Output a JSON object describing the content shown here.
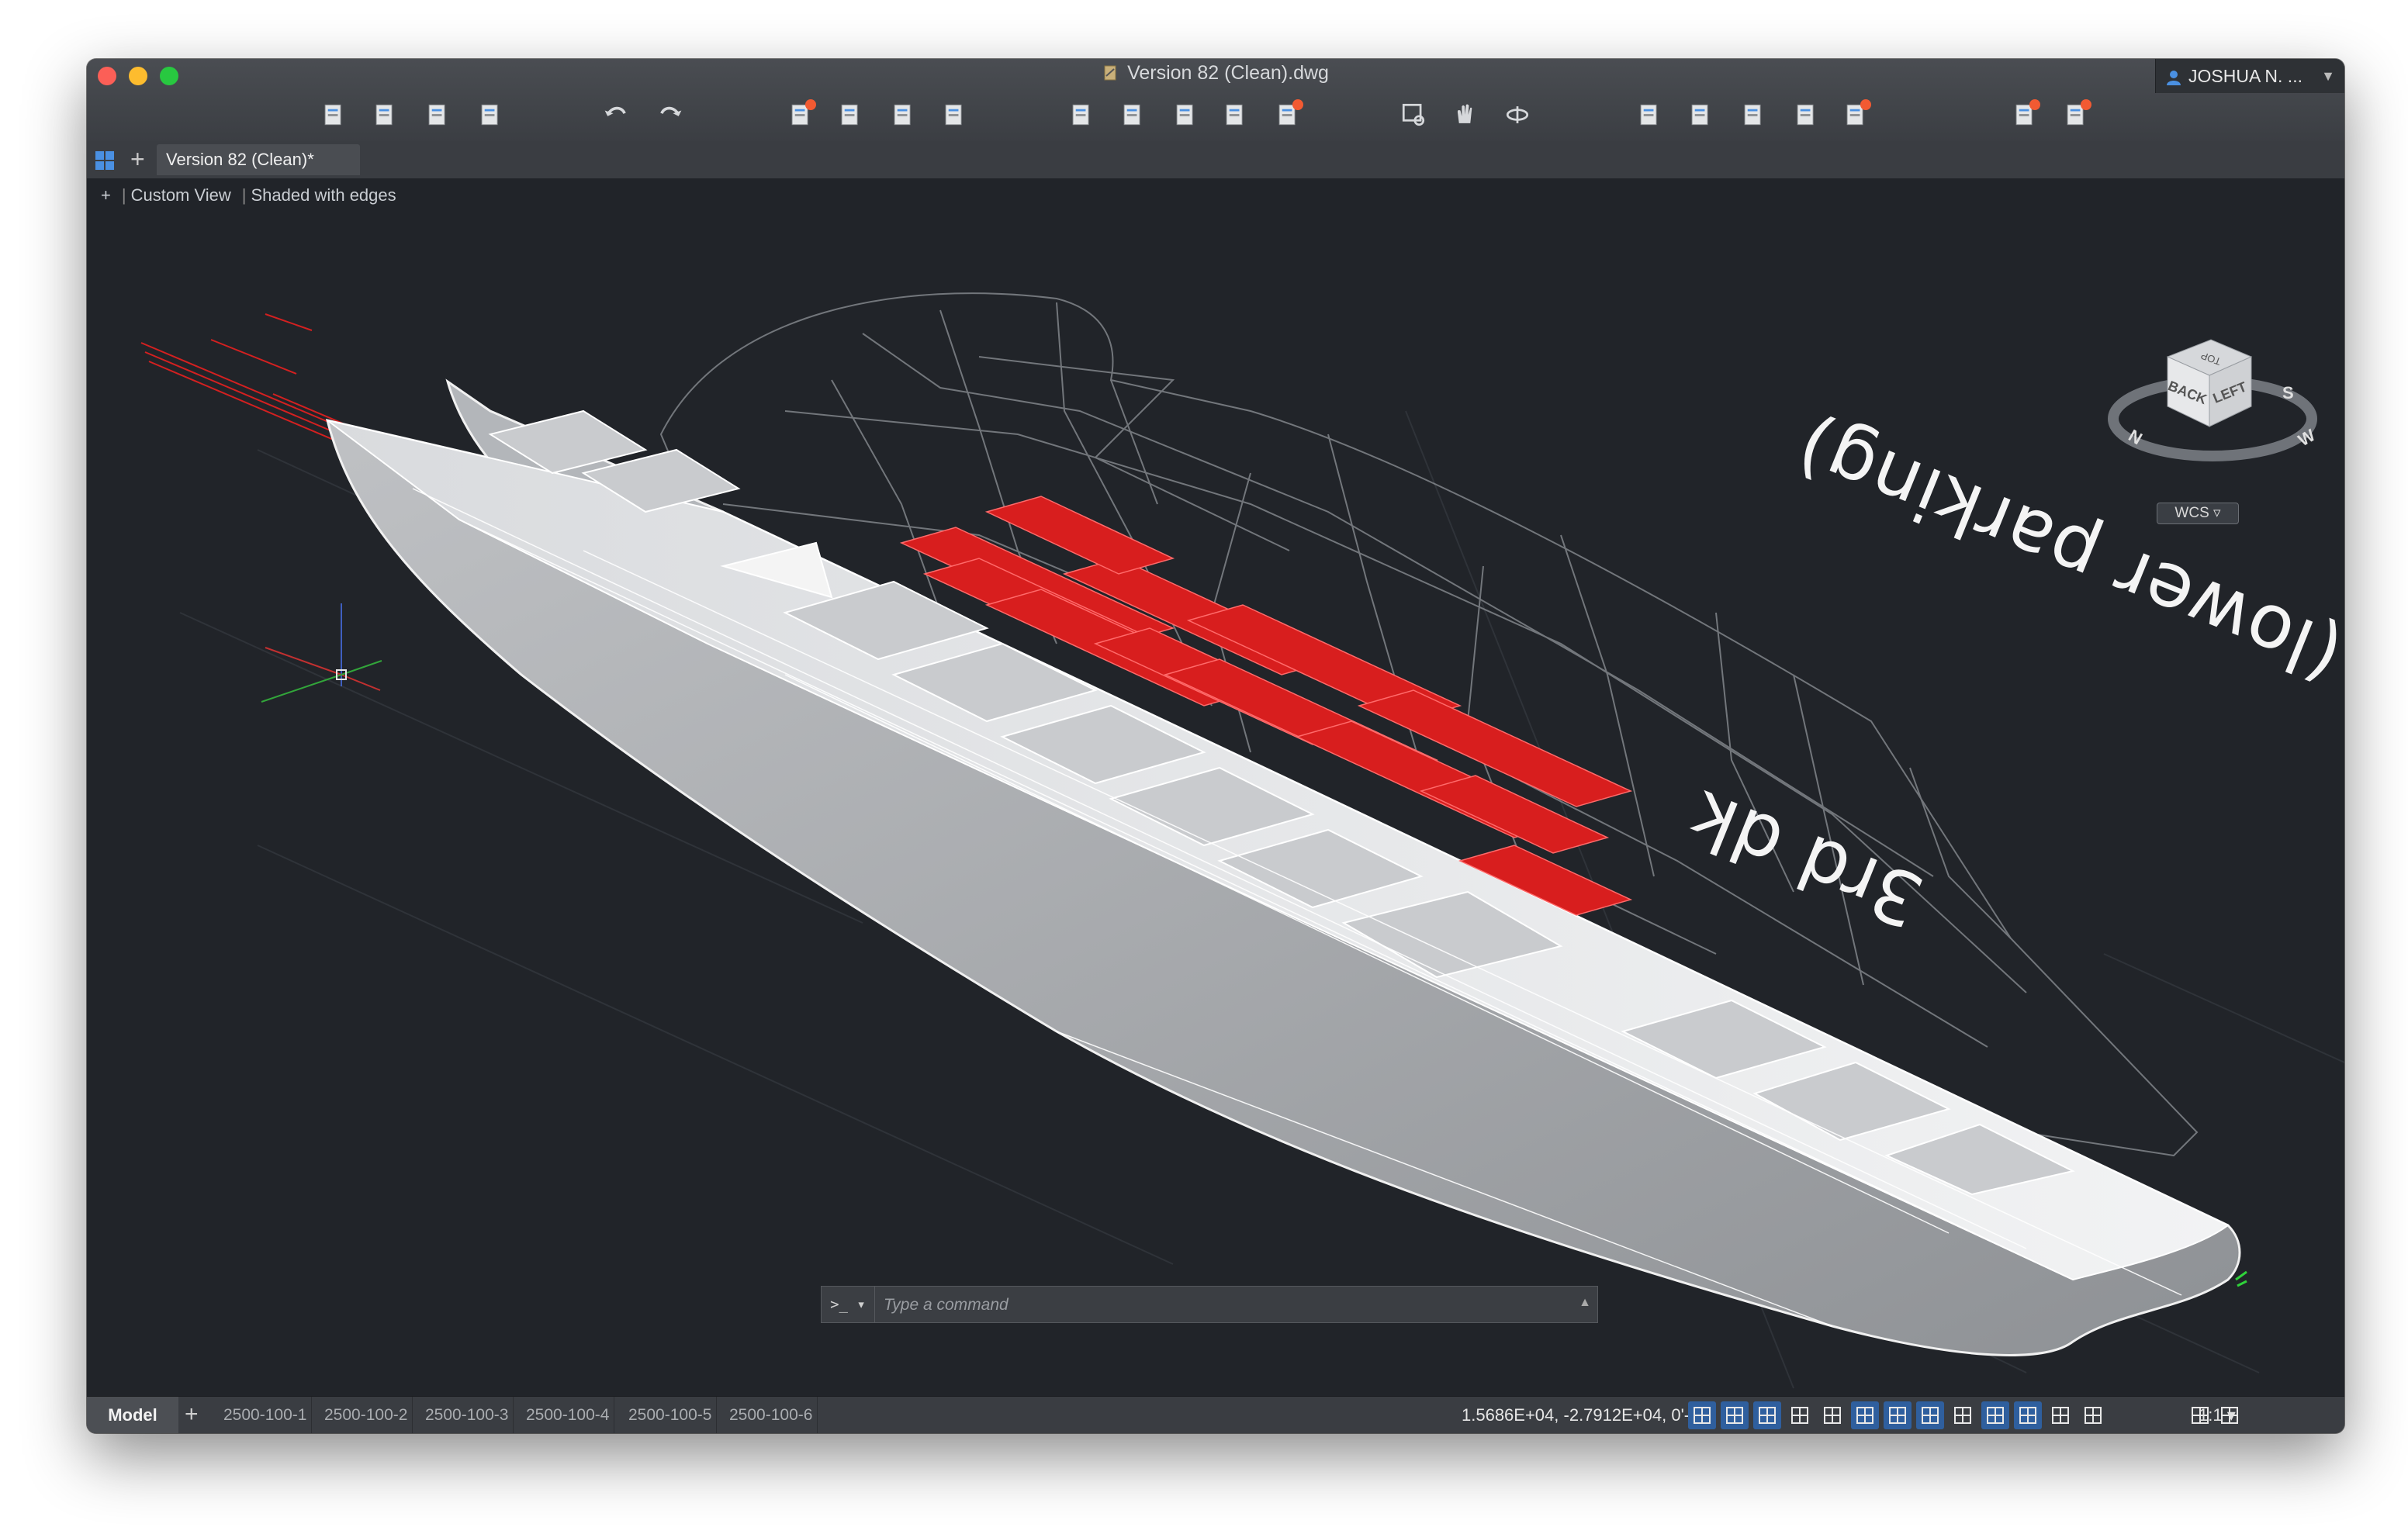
{
  "window": {
    "title": "Version 82 (Clean).dwg",
    "user_name": "JOSHUA N. ..."
  },
  "toolbar": {
    "icons": [
      "new-file-icon",
      "open-folder-icon",
      "save-icon",
      "save-as-icon",
      "undo-icon",
      "redo-icon",
      "plot-icon",
      "print-icon",
      "publish-icon",
      "page-setup-icon",
      "import-icon",
      "export-icon",
      "attach-icon",
      "xref-icon",
      "render-icon",
      "zoom-window-icon",
      "pan-icon",
      "orbit-icon",
      "properties-icon",
      "layers-icon",
      "online-icon",
      "share-icon",
      "apps-icon",
      "settings-icon",
      "sync-icon"
    ]
  },
  "tabs": {
    "document_tab": "Version 82 (Clean)*"
  },
  "viewport": {
    "plus": "+",
    "view_name": "Custom View",
    "visual_style": "Shaded with edges",
    "annotation_line1": "3rd dk",
    "annotation_line2": "(lower parking)",
    "viewcube": {
      "face_back": "BACK",
      "face_left": "LEFT",
      "face_top": "TOP",
      "compass_s": "S",
      "compass_w": "W",
      "compass_n": "N"
    },
    "ucs_label": "WCS",
    "colors": {
      "accent_red": "#e02020",
      "hull_white": "#e8e8e8",
      "background": "#212429"
    }
  },
  "command_line": {
    "prompt_symbol": ">_ ▾",
    "placeholder": "Type a command",
    "history_arrow": "▲"
  },
  "status": {
    "model_tab": "Model",
    "plus": "+",
    "layouts": [
      "2500-100-1",
      "2500-100-2",
      "2500-100-3",
      "2500-100-4",
      "2500-100-5",
      "2500-100-6"
    ],
    "coordinates": "1.5686E+04,   -2.7912E+04, 0'-0\"",
    "scale": "1:1 ▾"
  }
}
